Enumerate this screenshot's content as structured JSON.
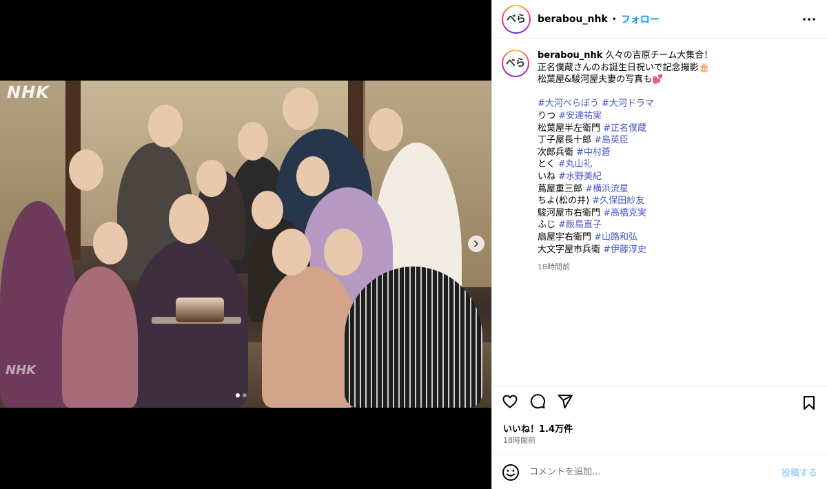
{
  "post": {
    "username": "berabou_nhk",
    "avatar_text": "べら",
    "header_sep": "•",
    "follow_label": "フォロー",
    "more_icon": "more-horizontal-icon",
    "media": {
      "logo_top": "NHK",
      "logo_bottom": "NHK",
      "slide_count": 2,
      "active_slide": 1
    },
    "caption": {
      "first_line": "久々の吉原チーム大集合！",
      "line2": "正名僕蔵さんのお誕生日祝いで記念撮影🎂",
      "line3": "松葉屋&駿河屋夫妻の写真も💕",
      "hashtags_line": [
        "#大河べらぼう",
        "#大河ドラマ"
      ],
      "cast": [
        {
          "role": "りつ",
          "tag": "#安達祐実"
        },
        {
          "role": "松葉屋半左衛門",
          "tag": "#正名僕蔵"
        },
        {
          "role": "丁子屋長十郎",
          "tag": "#島英臣"
        },
        {
          "role": "次郎兵衛",
          "tag": "#中村蒼"
        },
        {
          "role": "とく",
          "tag": "#丸山礼"
        },
        {
          "role": "いね",
          "tag": "#水野美紀"
        },
        {
          "role": "蔦屋重三郎",
          "tag": "#横浜流星"
        },
        {
          "role": "ちよ(松の井)",
          "tag": "#久保田紗友"
        },
        {
          "role": "駿河屋市右衛門",
          "tag": "#高橋克実"
        },
        {
          "role": "ふじ",
          "tag": "#飯島直子"
        },
        {
          "role": "扇屋宇右衛門",
          "tag": "#山路和弘"
        },
        {
          "role": "大文字屋市兵衛",
          "tag": "#伊藤淳史"
        }
      ],
      "time": "18時間前"
    },
    "likes": "いいね！1.4万件",
    "posted_time": "18時間前",
    "comment": {
      "placeholder": "コメントを追加...",
      "post_label": "投稿する"
    }
  }
}
